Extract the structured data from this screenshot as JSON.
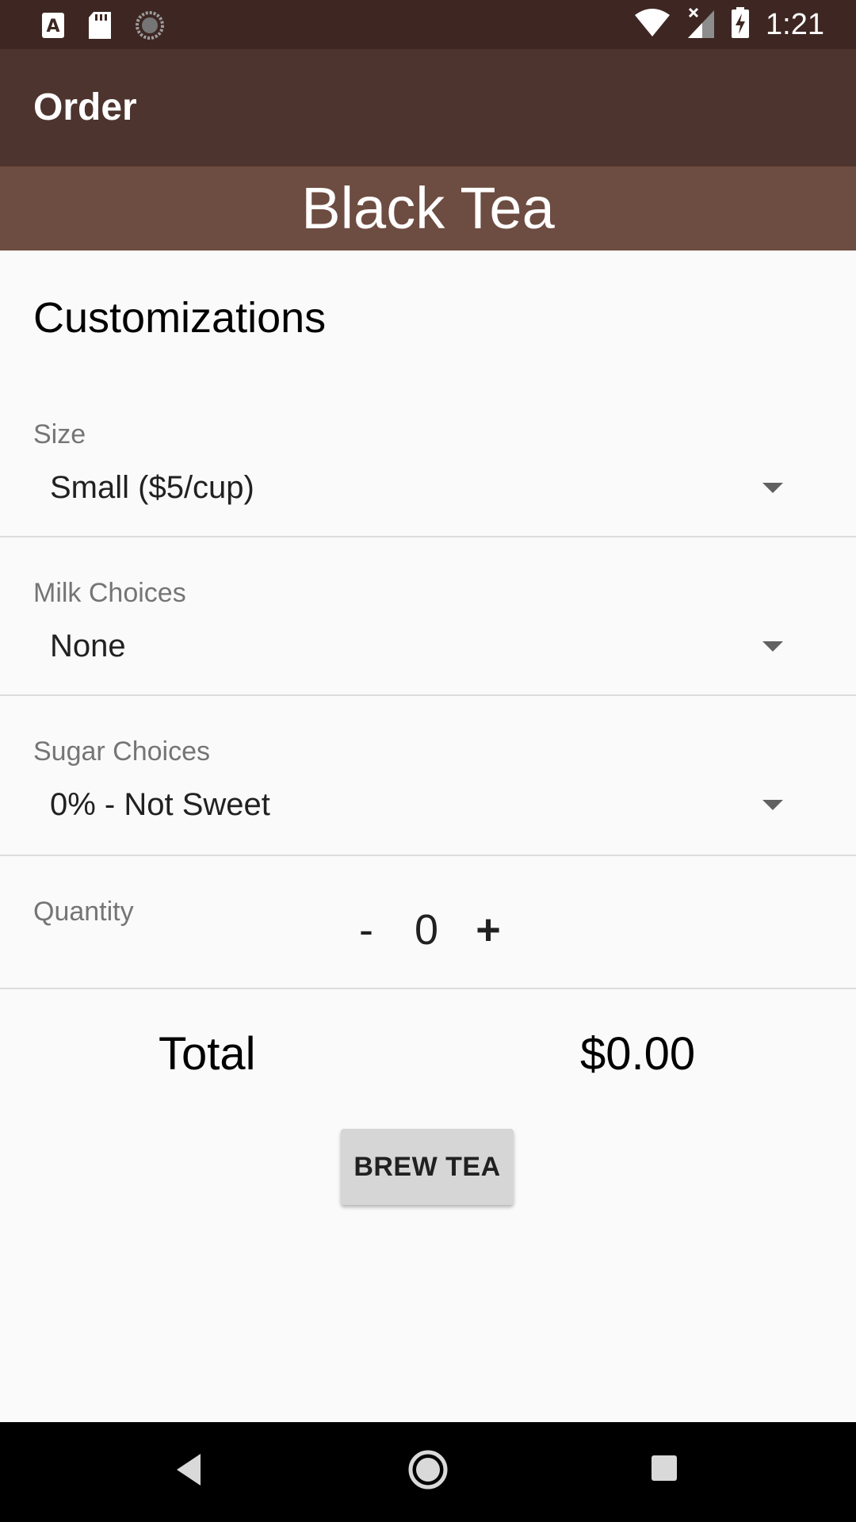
{
  "status_bar": {
    "time": "1:21",
    "left_icons": [
      "a-keyboard-icon",
      "sd-card-icon",
      "sync-spinner-icon"
    ],
    "right_icons": [
      "wifi-icon",
      "signal-no-data-icon",
      "battery-charging-icon"
    ]
  },
  "app_bar": {
    "title": "Order"
  },
  "product": {
    "name": "Black Tea"
  },
  "customizations": {
    "title": "Customizations",
    "size": {
      "label": "Size",
      "selected": "Small ($5/cup)"
    },
    "milk": {
      "label": "Milk Choices",
      "selected": "None"
    },
    "sugar": {
      "label": "Sugar Choices",
      "selected": "0% - Not Sweet"
    },
    "quantity": {
      "label": "Quantity",
      "decrement": "-",
      "value": "0",
      "increment": "+"
    }
  },
  "total": {
    "label": "Total",
    "value": "$0.00"
  },
  "actions": {
    "brew_label": "BREW TEA"
  },
  "colors": {
    "status_bar": "#3e2723",
    "app_bar": "#4e342e",
    "banner": "#6d4c41",
    "background": "#fafafa",
    "button": "#d6d6d6"
  },
  "nav_bar": {
    "icons": [
      "back-icon",
      "home-icon",
      "recents-icon"
    ]
  }
}
